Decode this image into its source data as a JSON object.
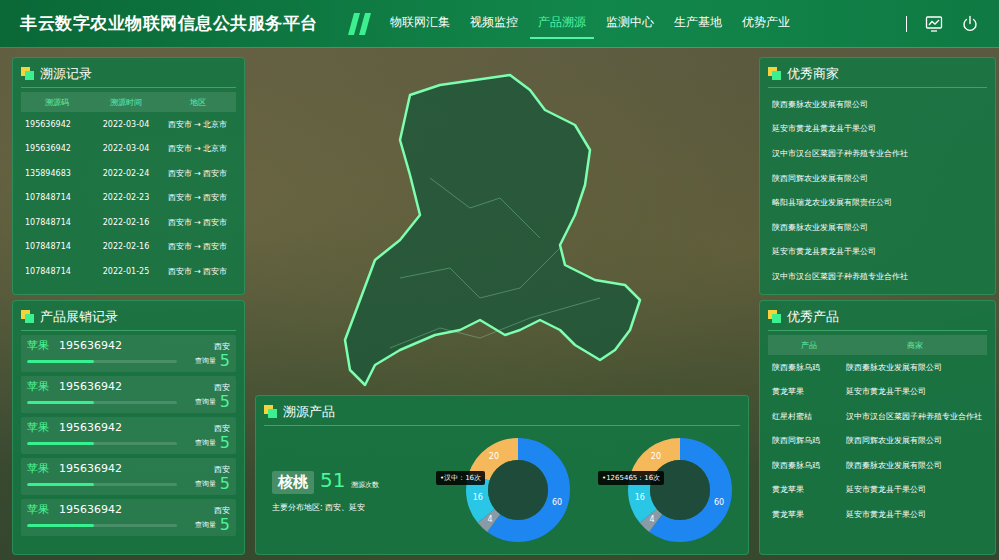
{
  "header": {
    "title": "丰云数字农业物联网信息公共服务平台",
    "tabs": [
      {
        "label": "物联网汇集",
        "selected": false
      },
      {
        "label": "视频监控",
        "selected": false
      },
      {
        "label": "产品溯源",
        "selected": true
      },
      {
        "label": "监测中心",
        "selected": false
      },
      {
        "label": "生产基地",
        "selected": false
      },
      {
        "label": "优势产业",
        "selected": false
      }
    ]
  },
  "trace_records": {
    "title": "溯源记录",
    "columns": [
      "溯源码",
      "溯源时间",
      "地区"
    ],
    "rows": [
      [
        "195636942",
        "2022-03-04",
        "西安市 → 北京市"
      ],
      [
        "195636942",
        "2022-03-04",
        "西安市 → 北京市"
      ],
      [
        "135894683",
        "2022-02-24",
        "西安市 → 西安市"
      ],
      [
        "107848714",
        "2022-02-23",
        "西安市 → 西安市"
      ],
      [
        "107848714",
        "2022-02-16",
        "西安市 → 西安市"
      ],
      [
        "107848714",
        "2022-02-16",
        "西安市 → 西安市"
      ],
      [
        "107848714",
        "2022-01-25",
        "西安市 → 西安市"
      ]
    ]
  },
  "sales_records": {
    "title": "产品展销记录",
    "items": [
      {
        "product": "苹果",
        "code": "195636942",
        "city": "西安",
        "query_label": "查询量",
        "count": "5",
        "level": 0.45
      },
      {
        "product": "苹果",
        "code": "195636942",
        "city": "西安",
        "query_label": "查询量",
        "count": "5",
        "level": 0.45
      },
      {
        "product": "苹果",
        "code": "195636942",
        "city": "西安",
        "query_label": "查询量",
        "count": "5",
        "level": 0.45
      },
      {
        "product": "苹果",
        "code": "195636942",
        "city": "西安",
        "query_label": "查询量",
        "count": "5",
        "level": 0.45
      },
      {
        "product": "苹果",
        "code": "195636942",
        "city": "西安",
        "query_label": "查询量",
        "count": "5",
        "level": 0.45
      }
    ]
  },
  "trace_product": {
    "title": "溯源产品",
    "product": "核桃",
    "count": "51",
    "count_label": "溯源次数",
    "distribution": "主要分布地区: 西安、延安",
    "charts": [
      {
        "tooltip": "•汉中：16次",
        "segments": [
          {
            "value": 60,
            "label": "60",
            "color": "#1e86f0"
          },
          {
            "value": 4,
            "label": "4",
            "color": "#8a9aa8"
          },
          {
            "value": 16,
            "label": "16",
            "color": "#2ac6e6"
          },
          {
            "value": 20,
            "label": "20",
            "color": "#f5b95c"
          }
        ]
      },
      {
        "tooltip": "•1265465：16次",
        "segments": [
          {
            "value": 60,
            "label": "60",
            "color": "#1e86f0"
          },
          {
            "value": 4,
            "label": "4",
            "color": "#8a9aa8"
          },
          {
            "value": 16,
            "label": "16",
            "color": "#2ac6e6"
          },
          {
            "value": 20,
            "label": "20",
            "color": "#f5b95c"
          }
        ]
      }
    ]
  },
  "merchants": {
    "title": "优秀商家",
    "items": [
      "陕西秦脉农业发展有限公司",
      "延安市黄龙县黄龙县干果公司",
      "汉中市汉台区菜园子种养殖专业合作社",
      "陕西同辉农业发展有限公司",
      "略阳县瑞龙农业发展有限责任公司",
      "陕西秦脉农业发展有限公司",
      "延安市黄龙县黄龙县干果公司",
      "汉中市汉台区菜园子种养殖专业合作社"
    ]
  },
  "products": {
    "title": "优秀产品",
    "columns": [
      "产品",
      "商家"
    ],
    "rows": [
      [
        "陕西秦脉乌鸡",
        "陕西秦脉农业发展有限公司"
      ],
      [
        "黄龙苹果",
        "延安市黄龙县干果公司"
      ],
      [
        "红星村蜜桔",
        "汉中市汉台区菜园子种养殖专业合作社"
      ],
      [
        "陕西同辉乌鸡",
        "陕西同辉农业发展有限公司"
      ],
      [
        "陕西秦脉乌鸡",
        "陕西秦脉农业发展有限公司"
      ],
      [
        "黄龙苹果",
        "延安市黄龙县干果公司"
      ],
      [
        "黄龙苹果",
        "延安市黄龙县干果公司"
      ]
    ]
  }
}
